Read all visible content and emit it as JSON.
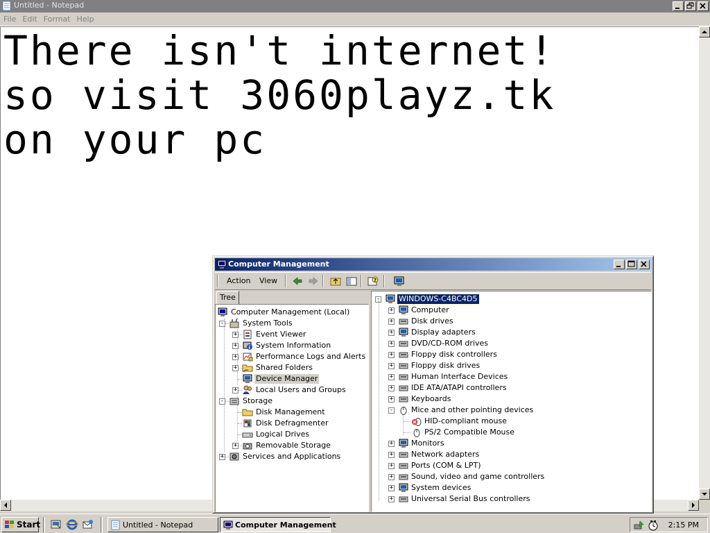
{
  "notepad": {
    "title": "Untitled - Notepad",
    "menu": [
      "File",
      "Edit",
      "Format",
      "Help"
    ],
    "text_lines": [
      "There isn't internet!",
      "so visit 3060playz.tk",
      "on your pc"
    ]
  },
  "cm": {
    "title": "Computer Management",
    "toolbar": {
      "action": "Action",
      "view": "View"
    },
    "tab": "Tree",
    "left_tree": [
      {
        "label": "Computer Management (Local)",
        "icon": "computer-management-icon"
      },
      {
        "label": "System Tools",
        "icon": "system-tools-icon"
      },
      {
        "label": "Event Viewer",
        "icon": "event-viewer-icon"
      },
      {
        "label": "System Information",
        "icon": "system-information-icon"
      },
      {
        "label": "Performance Logs and Alerts",
        "icon": "performance-logs-icon"
      },
      {
        "label": "Shared Folders",
        "icon": "shared-folders-icon"
      },
      {
        "label": "Device Manager",
        "icon": "device-manager-icon"
      },
      {
        "label": "Local Users and Groups",
        "icon": "local-users-icon"
      },
      {
        "label": "Storage",
        "icon": "storage-icon"
      },
      {
        "label": "Disk Management",
        "icon": "disk-management-icon"
      },
      {
        "label": "Disk Defragmenter",
        "icon": "disk-defragmenter-icon"
      },
      {
        "label": "Logical Drives",
        "icon": "logical-drives-icon"
      },
      {
        "label": "Removable Storage",
        "icon": "removable-storage-icon"
      },
      {
        "label": "Services and Applications",
        "icon": "services-applications-icon"
      }
    ],
    "right_tree": {
      "root": "WINDOWS-C4BC4D5",
      "items": [
        "Computer",
        "Disk drives",
        "Display adapters",
        "DVD/CD-ROM drives",
        "Floppy disk controllers",
        "Floppy disk drives",
        "Human Interface Devices",
        "IDE ATA/ATAPI controllers",
        "Keyboards",
        "Mice and other pointing devices",
        "HID-compliant mouse",
        "PS/2 Compatible Mouse",
        "Monitors",
        "Network adapters",
        "Ports (COM & LPT)",
        "Sound, video and game controllers",
        "System devices",
        "Universal Serial Bus controllers"
      ]
    }
  },
  "taskbar": {
    "start": "Start",
    "tasks": [
      "Untitled - Notepad",
      "Computer Management"
    ],
    "clock": "2:15 PM"
  }
}
